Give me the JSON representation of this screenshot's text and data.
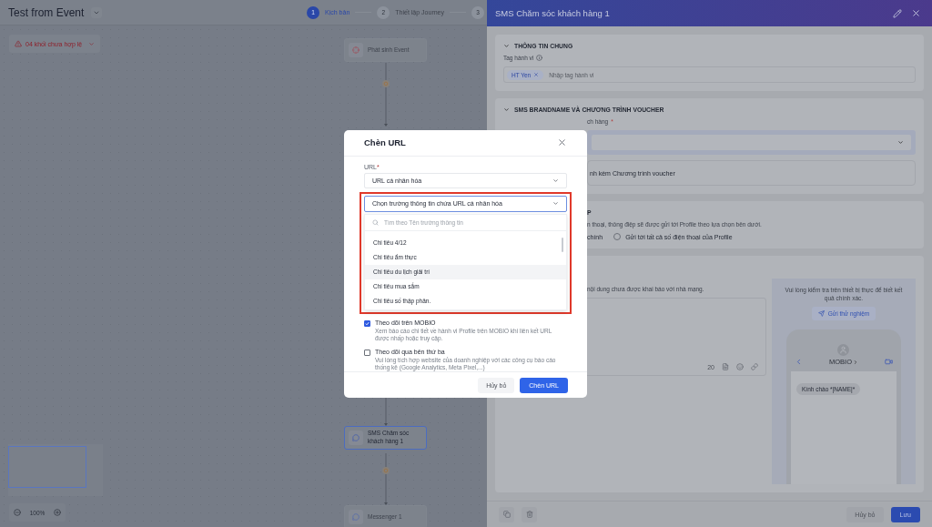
{
  "canvas": {
    "title": "Test from Event",
    "steps": [
      {
        "number": "1",
        "label": "Kịch bản",
        "selected": true
      },
      {
        "number": "2",
        "label": "Thiết lập Journey",
        "selected": false
      },
      {
        "number": "3",
        "selected": false
      }
    ],
    "warning": "04 khối chưa hợp lệ",
    "nodes": [
      {
        "kind": "event",
        "label": "Phát sinh Event",
        "selected": false
      },
      {
        "kind": "sms",
        "label": "SMS Chăm sóc khách hàng 1",
        "selected": true
      },
      {
        "kind": "messenger",
        "label": "Messenger 1",
        "selected": false
      }
    ],
    "zoom": "100%"
  },
  "panel": {
    "title": "SMS Chăm sóc khách hàng 1",
    "general": {
      "heading": "THÔNG TIN CHUNG",
      "expanded": true,
      "tag_label": "Tag hành vi",
      "tags": [
        "HT Yen"
      ],
      "tag_placeholder": "Nhập tag hành vi"
    },
    "brandname": {
      "heading": "SMS BRANDNAME VÀ CHƯƠNG TRÌNH VOUCHER",
      "expanded": true,
      "field_label": "ch hàng",
      "required_mark": "*",
      "voucher_option": "nh kèm Chương trình voucher"
    },
    "recipients": {
      "heading": "P",
      "hint": "n thoại, thông điệp sẽ được gửi tới Profile theo lựa chọn bên dưới.",
      "partial_option": "chính",
      "option": {
        "label": "Gửi tới tất cả số điện thoại của Profile",
        "selected": false
      }
    },
    "content": {
      "hint": "nội dung chưa được khai báo với nhà mạng.",
      "char_count": "20",
      "preview_note": "Vui lòng kiểm tra trên thiết bị thực để biết kết quả chính xác.",
      "test_button": "Gửi thử nghiệm",
      "sender": "MOBIO",
      "message": "Kính chào *|NAME|*"
    },
    "footer": {
      "cancel": "Hủy bỏ",
      "save": "Lưu"
    }
  },
  "dialog": {
    "title": "Chèn URL",
    "url_label": "URL",
    "required_mark": "*",
    "url_type": "URL cá nhân hóa",
    "field_placeholder": "Chọn trường thông tin chứa URL cá nhân hóa",
    "search_placeholder": "Tìm theo Tên trường thông tin",
    "options": [
      {
        "label": "Chi tiêu 4/12",
        "hovered": false
      },
      {
        "label": "Chi tiêu ẩm thực",
        "hovered": false
      },
      {
        "label": "Chi tiêu du lịch giải trí",
        "hovered": true
      },
      {
        "label": "Chi tiêu mua sắm",
        "hovered": false
      },
      {
        "label": "Chi tiêu số thập phân.",
        "hovered": false
      }
    ],
    "tracking": [
      {
        "label": "Theo dõi trên MOBIO",
        "description": "Xem báo cáo chi tiết về hành vi Profile trên MOBIO khi liên kết URL được nhấp hoặc truy cập.",
        "checked": true
      },
      {
        "label": "Theo dõi qua bên thứ ba",
        "description": "Vui lòng tích hợp website của doanh nghiệp với các công cụ báo cáo thống kê (Google Analytics, Meta Pixel,...)",
        "checked": false
      }
    ],
    "cancel": "Hủy bỏ",
    "confirm": "Chèn URL"
  }
}
